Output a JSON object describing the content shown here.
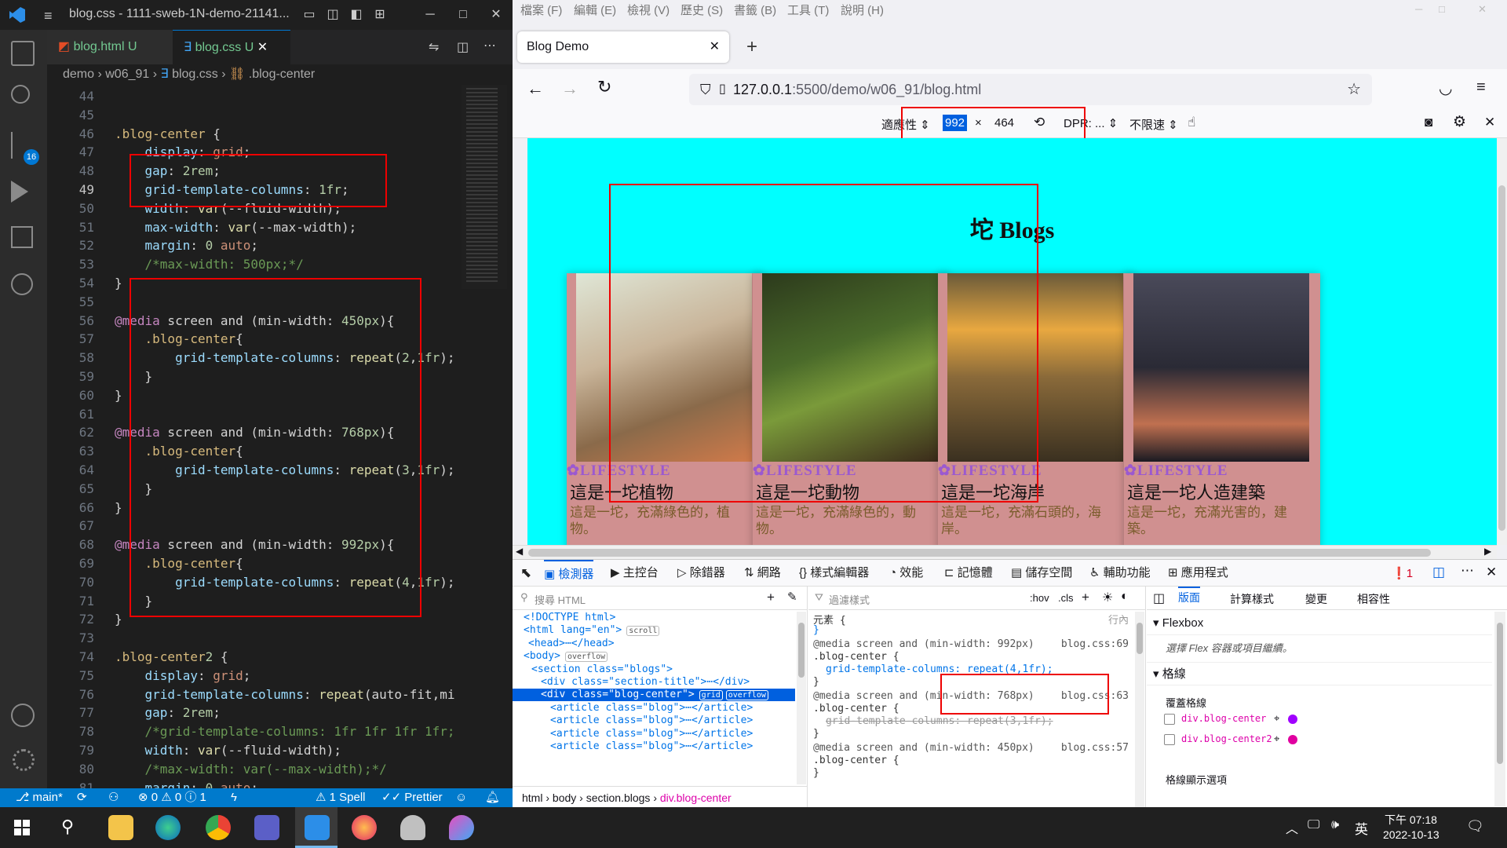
{
  "vscode": {
    "window_title": "blog.css - 1111-sweb-1N-demo-21141...",
    "tabs": [
      {
        "label": "blog.html",
        "status": "U",
        "icon": "html-icon"
      },
      {
        "label": "blog.css",
        "status": "U",
        "icon": "css-icon"
      }
    ],
    "breadcrumb": [
      "demo",
      "w06_91",
      "blog.css",
      ".blog-center"
    ],
    "line_numbers": [
      "44",
      "45",
      "46",
      "47",
      "48",
      "49",
      "50",
      "51",
      "52",
      "53",
      "54",
      "55",
      "56",
      "57",
      "58",
      "59",
      "60",
      "61",
      "62",
      "63",
      "64",
      "65",
      "66",
      "67",
      "68",
      "69",
      "70",
      "71",
      "72",
      "73",
      "74",
      "75",
      "76",
      "77",
      "78",
      "79",
      "80",
      "81"
    ],
    "code_lines": [
      "",
      "",
      ".blog-center {",
      "    display: grid;",
      "    gap: 2rem;",
      "    grid-template-columns: 1fr;",
      "    width: var(--fluid-width);",
      "    max-width: var(--max-width);",
      "    margin: 0 auto;",
      "    /*max-width: 500px;*/",
      "}",
      "",
      "@media screen and (min-width: 450px){",
      "    .blog-center{",
      "        grid-template-columns: repeat(2,1fr);",
      "    }",
      "}",
      "",
      "@media screen and (min-width: 768px){",
      "    .blog-center{",
      "        grid-template-columns: repeat(3,1fr);",
      "    }",
      "}",
      "",
      "@media screen and (min-width: 992px){",
      "    .blog-center{",
      "        grid-template-columns: repeat(4,1fr);",
      "    }",
      "}",
      "",
      ".blog-center2 {",
      "    display: grid;",
      "    grid-template-columns: repeat(auto-fit,mi",
      "    gap: 2rem;",
      "    /*grid-template-columns: 1fr 1fr 1fr 1fr;",
      "    width: var(--fluid-width);",
      "    /*max-width: var(--max-width);*/",
      "    margin: 0 auto;"
    ],
    "status": {
      "branch": "main*",
      "problems": "⊗ 0 ⚠ 0 ⓘ 1",
      "spell": "⚠ 1 Spell",
      "prettier": "✓✓ Prettier"
    }
  },
  "firefox": {
    "menu": [
      "檔案 (F)",
      "編輯 (E)",
      "檢視 (V)",
      "歷史 (S)",
      "書籤 (B)",
      "工具 (T)",
      "說明 (H)"
    ],
    "tab_title": "Blog Demo",
    "url_host": "127.0.0.1",
    "url_rest": ":5500/demo/w06_91/blog.html",
    "rdm": {
      "device": "適應性",
      "width": "992",
      "height": "464",
      "dpr": "DPR: ...",
      "throttle": "不限速"
    },
    "page": {
      "title": "坨 Blogs",
      "cards": [
        {
          "category": "LIFESTYLE",
          "title": "這是一坨植物",
          "desc": "這是一坨，充滿綠色的，植物。"
        },
        {
          "category": "LIFESTYLE",
          "title": "這是一坨動物",
          "desc": "這是一坨，充滿綠色的，動物。"
        },
        {
          "category": "LIFESTYLE",
          "title": "這是一坨海岸",
          "desc": "這是一坨，充滿石頭的，海岸。"
        },
        {
          "category": "LIFESTYLE",
          "title": "這是一坨人造建築",
          "desc": "這是一坨，充滿光害的，建築。"
        }
      ]
    },
    "devtools": {
      "tabs": [
        "檢測器",
        "主控台",
        "除錯器",
        "網路",
        "樣式編輯器",
        "效能",
        "記憶體",
        "儲存空間",
        "輔助功能",
        "應用程式"
      ],
      "error_count": "1",
      "search_html_placeholder": "搜尋 HTML",
      "filter_placeholder": "過濾樣式",
      "hov": ":hov",
      "cls": ".cls",
      "html_tree": [
        "<!DOCTYPE html>",
        "<html lang=\"en\">",
        "<head>⋯</head>",
        "<body>",
        "<section class=\"blogs\">",
        "<div class=\"section-title\">⋯</div>",
        "<div class=\"blog-center\">",
        "<article class=\"blog\">⋯</article>",
        "<article class=\"blog\">⋯</article>",
        "<article class=\"blog\">⋯</article>",
        "<article class=\"blog\">⋯</article>"
      ],
      "badges": {
        "scroll": "scroll",
        "overflow": "overflow",
        "grid": "grid"
      },
      "breadcrumb": [
        "html",
        "body",
        "section.blogs",
        "div.blog-center"
      ],
      "rules": [
        {
          "media": "",
          "selector": "元素 {",
          "decl": "}",
          "source": "行內"
        },
        {
          "media": "@media screen and (min-width: 992px)",
          "selector": ".blog-center {",
          "decl": "grid-template-columns: repeat(4,1fr);",
          "source": "blog.css:69"
        },
        {
          "media": "@media screen and (min-width: 768px)",
          "selector": ".blog-center {",
          "decl": "grid-template-columns: repeat(3,1fr);",
          "source": "blog.css:63"
        },
        {
          "media": "@media screen and (min-width: 450px)",
          "selector": ".blog-center {",
          "decl": "",
          "source": "blog.css:57"
        }
      ],
      "layout_tabs": [
        "版面",
        "計算樣式",
        "變更",
        "相容性"
      ],
      "flexbox_title": "Flexbox",
      "flexbox_hint": "選擇 Flex 容器或項目繼續。",
      "grid_title": "格線",
      "overlay_title": "覆蓋格線",
      "overlays": [
        {
          "label": "div.blog-center",
          "color": "#a000ff"
        },
        {
          "label": "div.blog-center2",
          "color": "#e000a0"
        }
      ],
      "grid_display_title": "格線顯示選項"
    }
  },
  "taskbar": {
    "time": "下午 07:18",
    "date": "2022-10-13",
    "ime": "英"
  }
}
